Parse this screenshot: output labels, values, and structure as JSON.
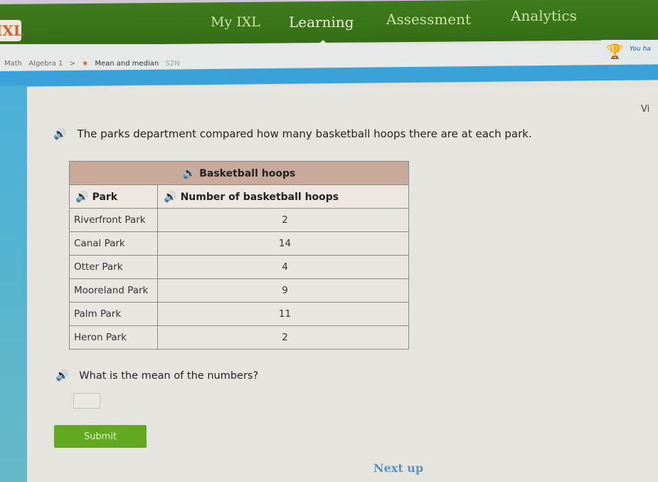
{
  "nav": {
    "logo": "IXL",
    "items": [
      {
        "label": "My IXL",
        "active": false
      },
      {
        "label": "Learning",
        "active": true
      },
      {
        "label": "Assessment",
        "active": false
      },
      {
        "label": "Analytics",
        "active": false
      }
    ]
  },
  "breadcrumb": {
    "subject": "Math",
    "grade": "Algebra 1",
    "separator": ">",
    "skill": "Mean and median",
    "code": "S2N"
  },
  "award": {
    "icon": "trophy-icon",
    "text": "You ha"
  },
  "side_label": "Vi",
  "question": {
    "prompt": "The parks department compared how many basketball hoops there are at each park.",
    "table": {
      "title": "Basketball hoops",
      "columns": [
        "Park",
        "Number of basketball hoops"
      ],
      "rows": [
        {
          "park": "Riverfront Park",
          "hoops": "2"
        },
        {
          "park": "Canal Park",
          "hoops": "14"
        },
        {
          "park": "Otter Park",
          "hoops": "4"
        },
        {
          "park": "Mooreland Park",
          "hoops": "9"
        },
        {
          "park": "Palm Park",
          "hoops": "11"
        },
        {
          "park": "Heron Park",
          "hoops": "2"
        }
      ]
    },
    "ask": "What is the mean of the numbers?",
    "answer_value": "",
    "submit_label": "Submit"
  },
  "next_up": "Next up",
  "icons": {
    "speaker": "🔊"
  }
}
